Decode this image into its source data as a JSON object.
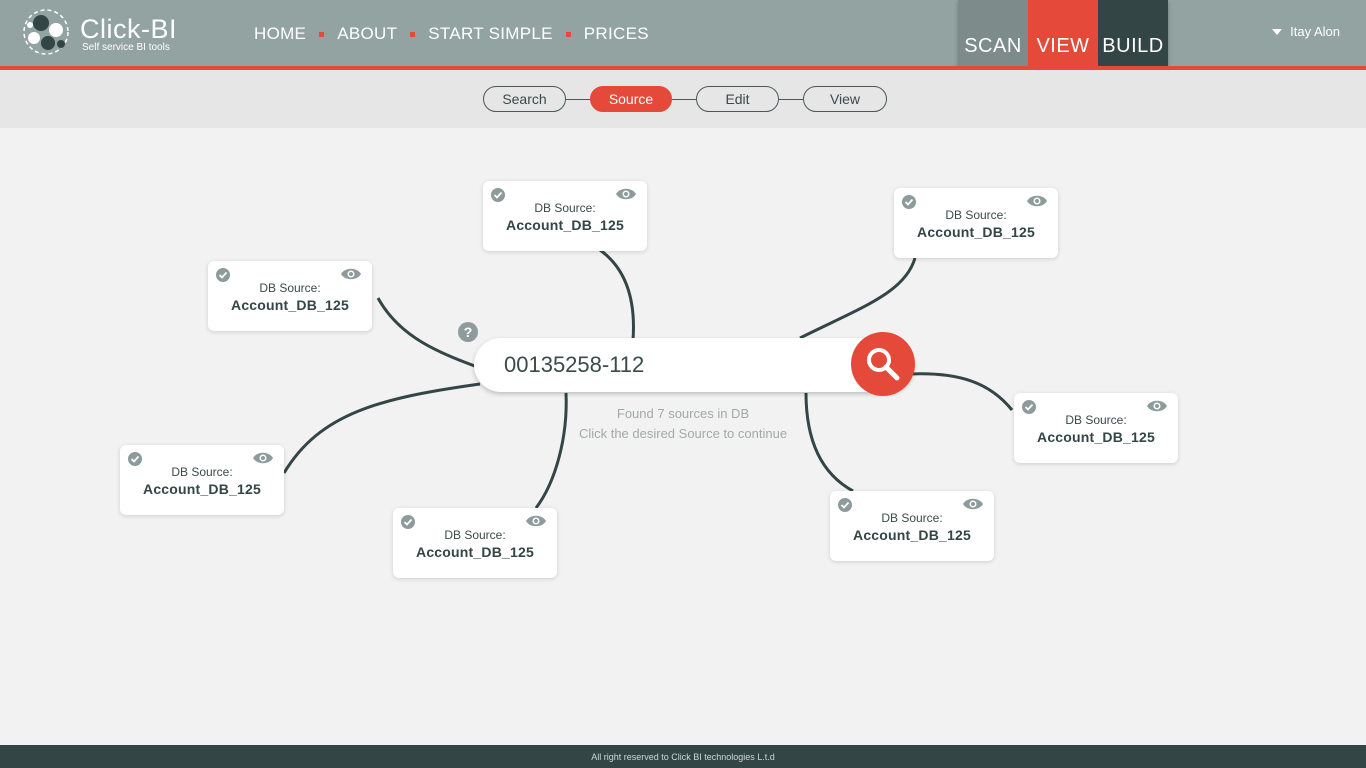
{
  "brand": {
    "name": "Click-BI",
    "tagline": "Self service BI tools"
  },
  "nav": [
    "HOME",
    "ABOUT",
    "START SIMPLE",
    "PRICES"
  ],
  "modes": [
    "SCAN",
    "VIEW",
    "BUILD"
  ],
  "active_mode": "VIEW",
  "user": {
    "name": "Itay Alon"
  },
  "steps": [
    {
      "label": "Search",
      "active": false
    },
    {
      "label": "Source",
      "active": true
    },
    {
      "label": "Edit",
      "active": false
    },
    {
      "label": "View",
      "active": false
    }
  ],
  "search": {
    "value": "00135258-112"
  },
  "status": {
    "line1": "Found 7 sources in DB",
    "line2": "Click the desired Source to continue"
  },
  "sources": [
    {
      "label": "DB Source:",
      "value": "Account_DB_125"
    },
    {
      "label": "DB Source:",
      "value": "Account_DB_125"
    },
    {
      "label": "DB Source:",
      "value": "Account_DB_125"
    },
    {
      "label": "DB Source:",
      "value": "Account_DB_125"
    },
    {
      "label": "DB Source:",
      "value": "Account_DB_125"
    },
    {
      "label": "DB Source:",
      "value": "Account_DB_125"
    },
    {
      "label": "DB Source:",
      "value": "Account_DB_125"
    }
  ],
  "footer": "All right reserved to Click BI technologies L.t.d",
  "colors": {
    "accent": "#e5493a",
    "header": "#93a3a2",
    "dark": "#344545",
    "check": "#8d9c9b"
  }
}
